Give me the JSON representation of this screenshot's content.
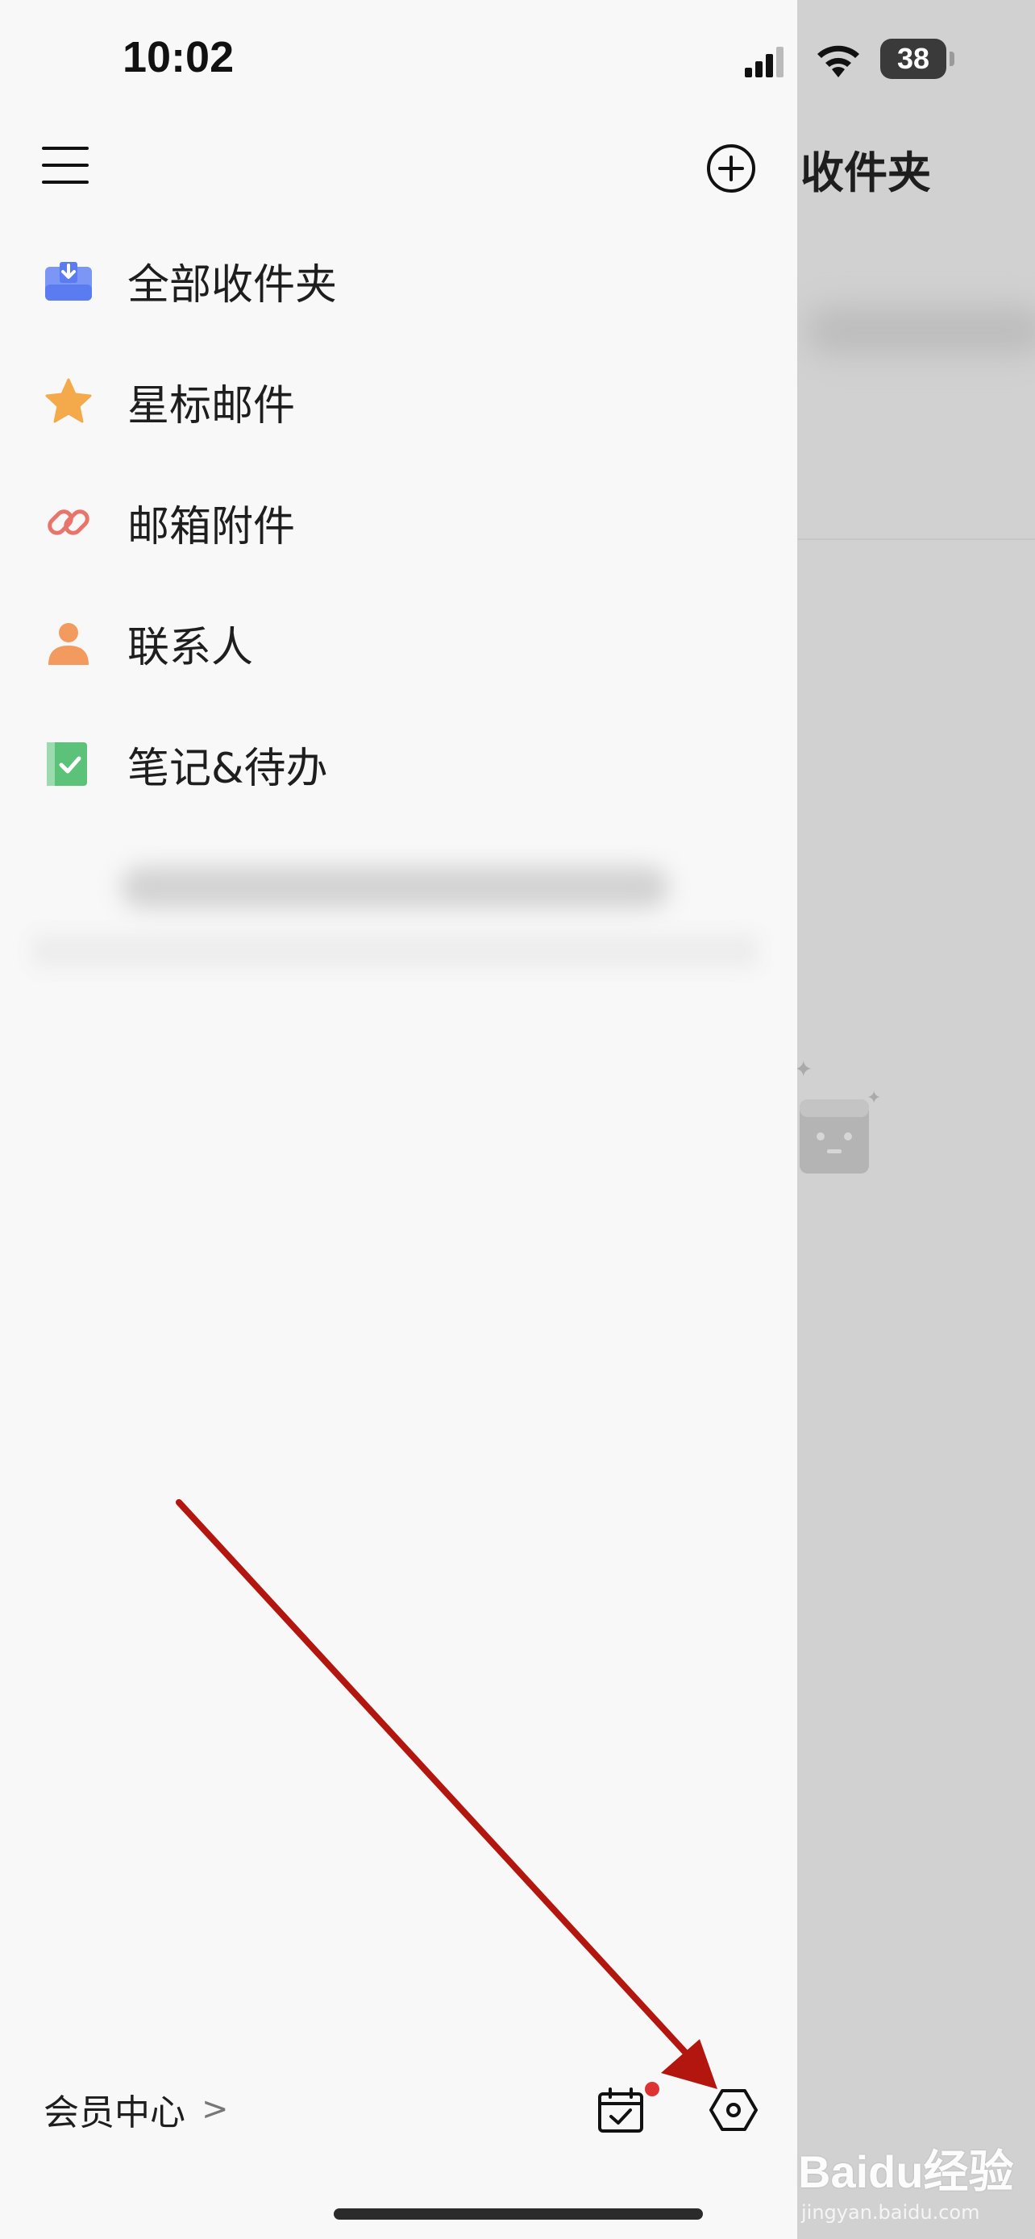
{
  "status_bar": {
    "time": "10:02",
    "battery": "38"
  },
  "main": {
    "title": "收件夹"
  },
  "drawer": {
    "menu": [
      {
        "label": "全部收件夹",
        "icon": "inbox-tray-icon",
        "color": "#5b7cf0"
      },
      {
        "label": "星标邮件",
        "icon": "star-icon",
        "color": "#f4a94a"
      },
      {
        "label": "邮箱附件",
        "icon": "paperclip-icon",
        "color": "#e8756a"
      },
      {
        "label": "联系人",
        "icon": "person-icon",
        "color": "#f39a5e"
      },
      {
        "label": "笔记&待办",
        "icon": "note-check-icon",
        "color": "#5cc27a"
      }
    ],
    "vip_label": "会员中心",
    "vip_chevron": ">"
  },
  "watermark": {
    "main": "Baidu经验",
    "sub": "jingyan.baidu.com"
  },
  "colors": {
    "annotation_arrow": "#b3160f",
    "drawer_bg": "#f8f8f8",
    "overlay_bg": "#d1d1d1"
  }
}
